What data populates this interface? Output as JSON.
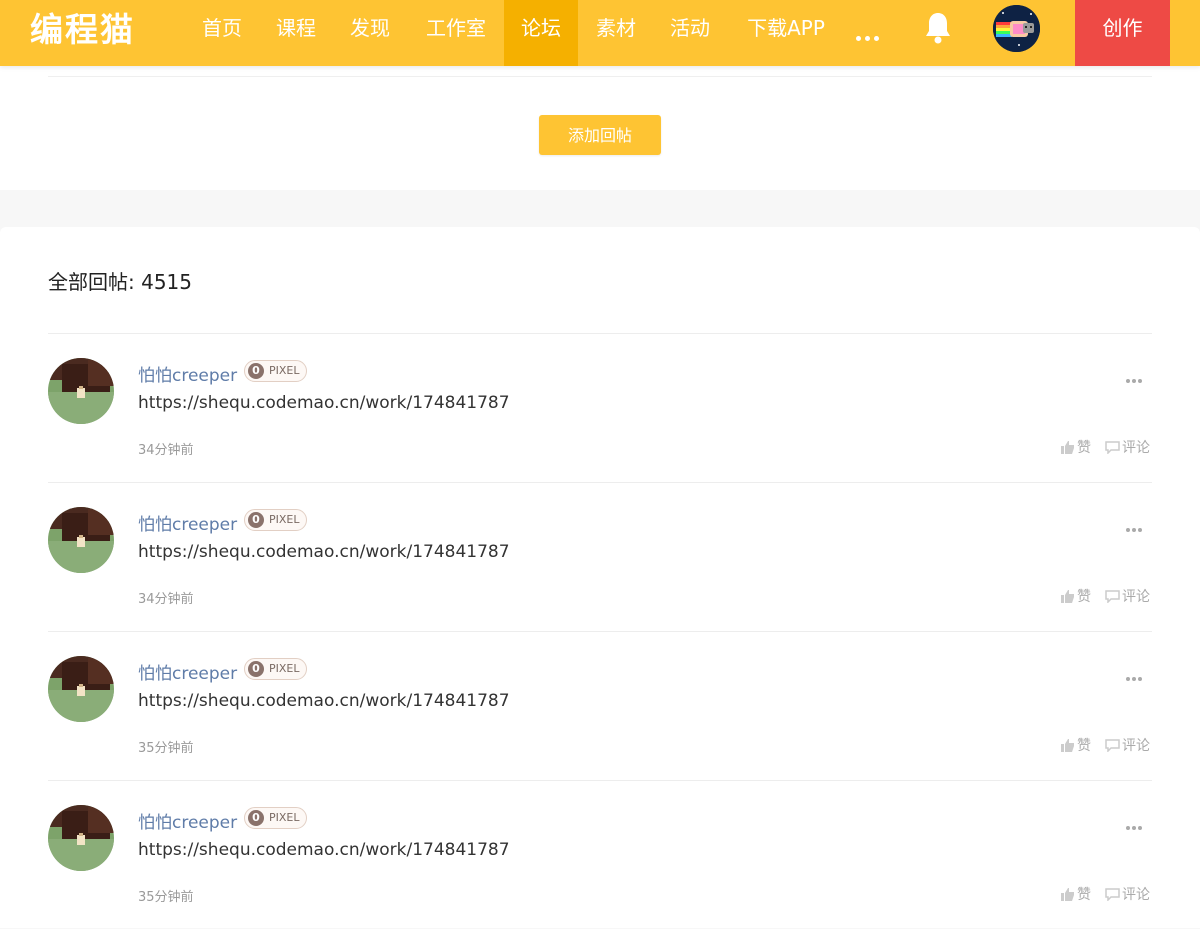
{
  "header": {
    "logo": "编程猫",
    "nav": [
      {
        "label": "首页"
      },
      {
        "label": "课程"
      },
      {
        "label": "发现"
      },
      {
        "label": "工作室"
      },
      {
        "label": "论坛",
        "active": true
      },
      {
        "label": "素材"
      },
      {
        "label": "活动"
      },
      {
        "label": "下载APP"
      }
    ],
    "more_icon": "more-dots-icon",
    "bell_icon": "bell-icon",
    "create_label": "创作",
    "colors": {
      "bar": "#fec433",
      "active": "#f5b000",
      "create": "#ee4a45"
    }
  },
  "composer": {
    "add_reply_label": "添加回帖"
  },
  "replies": {
    "count_label": "全部回帖: 4515",
    "items": [
      {
        "author": "怕怕creeper",
        "badge_level": "0",
        "badge_text": "PIXEL",
        "content": "https://shequ.codemao.cn/work/174841787",
        "time": "34分钟前",
        "like_label": "赞",
        "comment_label": "评论"
      },
      {
        "author": "怕怕creeper",
        "badge_level": "0",
        "badge_text": "PIXEL",
        "content": "https://shequ.codemao.cn/work/174841787",
        "time": "34分钟前",
        "like_label": "赞",
        "comment_label": "评论"
      },
      {
        "author": "怕怕creeper",
        "badge_level": "0",
        "badge_text": "PIXEL",
        "content": "https://shequ.codemao.cn/work/174841787",
        "time": "35分钟前",
        "like_label": "赞",
        "comment_label": "评论"
      },
      {
        "author": "怕怕creeper",
        "badge_level": "0",
        "badge_text": "PIXEL",
        "content": "https://shequ.codemao.cn/work/174841787",
        "time": "35分钟前",
        "like_label": "赞",
        "comment_label": "评论"
      }
    ]
  }
}
